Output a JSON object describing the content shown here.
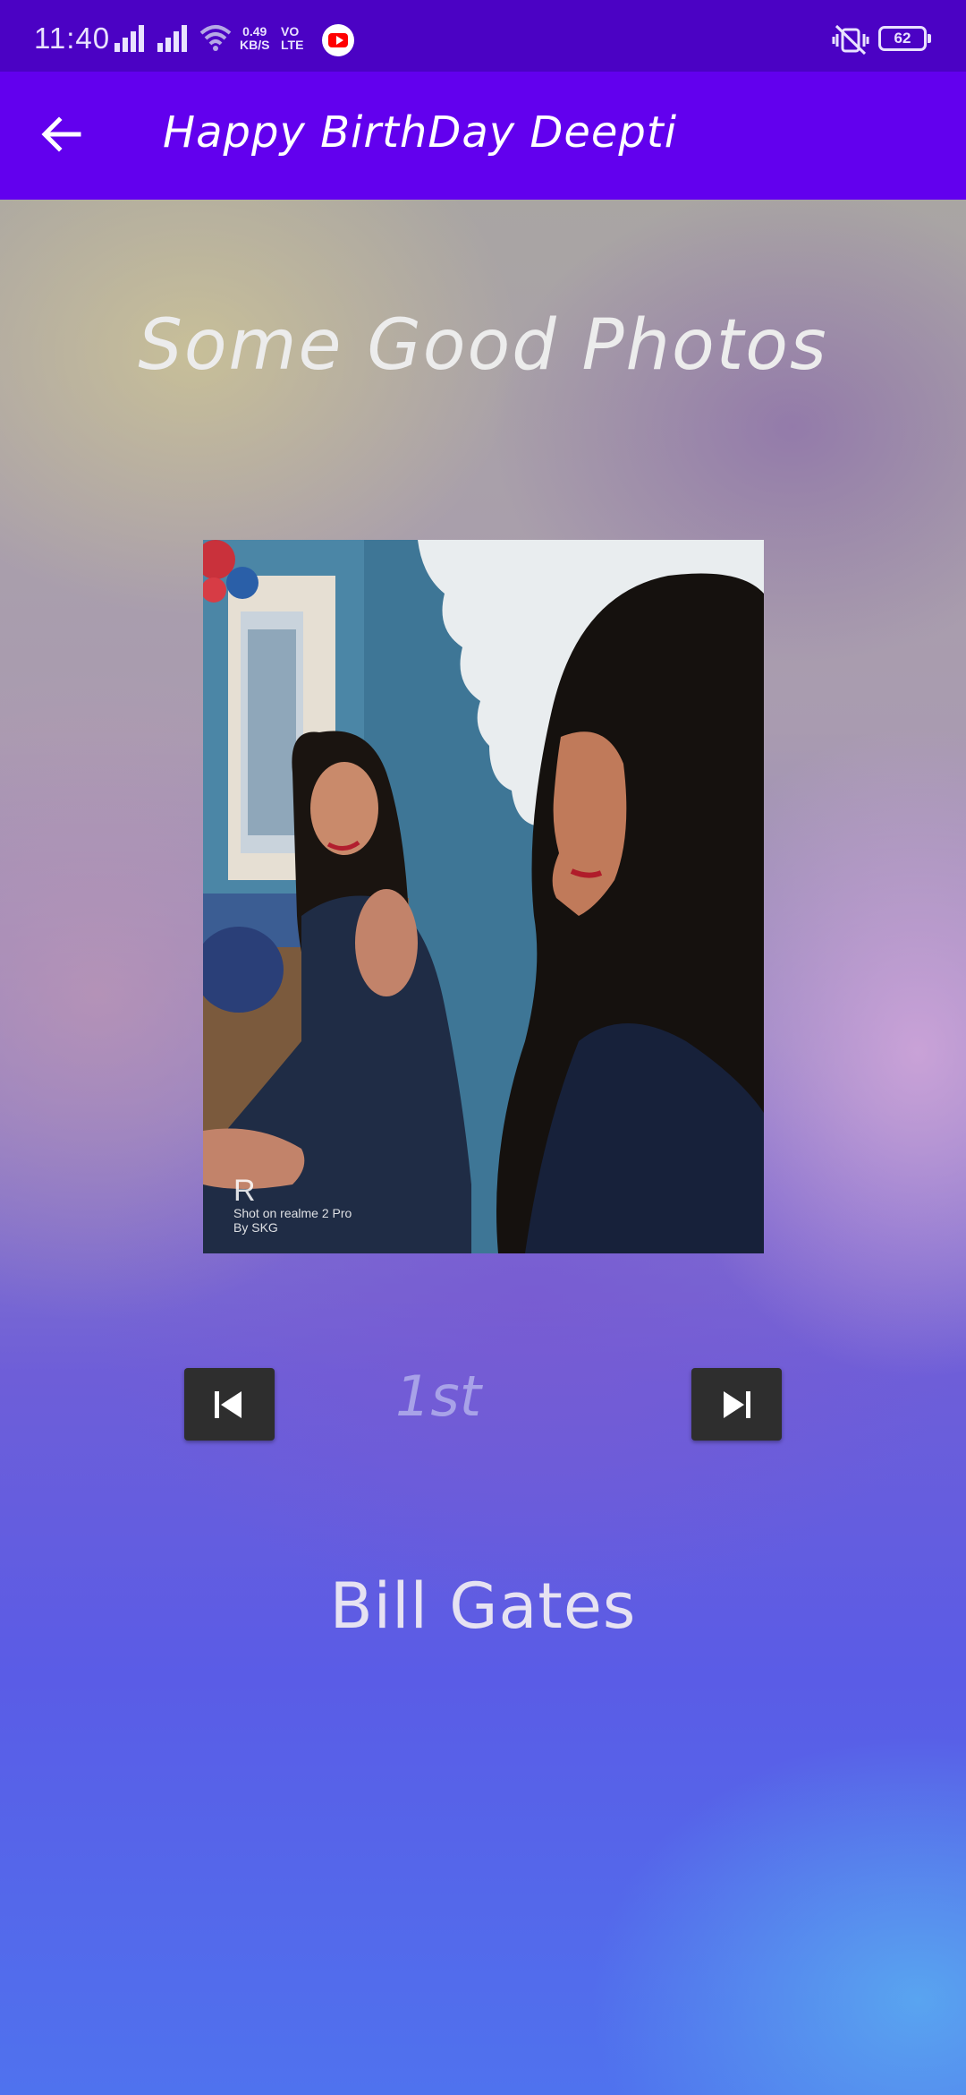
{
  "status_bar": {
    "time": "11:40",
    "speed_value": "0.49",
    "speed_unit": "KB/S",
    "volte_top": "VO",
    "volte_bottom": "LTE",
    "battery": "62",
    "icons": [
      "signal-icon",
      "wifi-icon",
      "youtube-icon",
      "vibrate-mute-icon",
      "battery-icon"
    ]
  },
  "app_bar": {
    "title": "Happy BirthDay Deepti",
    "back_icon": "arrow-left-icon"
  },
  "content": {
    "heading": "Some Good Photos",
    "photo": {
      "watermark_line1": "Shot on realme 2 Pro",
      "watermark_line2": "By SKG",
      "watermark_logo": "R"
    },
    "navigation": {
      "prev_icon": "skip-previous-icon",
      "next_icon": "skip-next-icon",
      "index_label": "1st"
    },
    "caption": "Bill Gates"
  },
  "colors": {
    "status_bar": "#4b02c4",
    "app_bar": "#6200ee",
    "nav_button": "#2e2e2e"
  }
}
